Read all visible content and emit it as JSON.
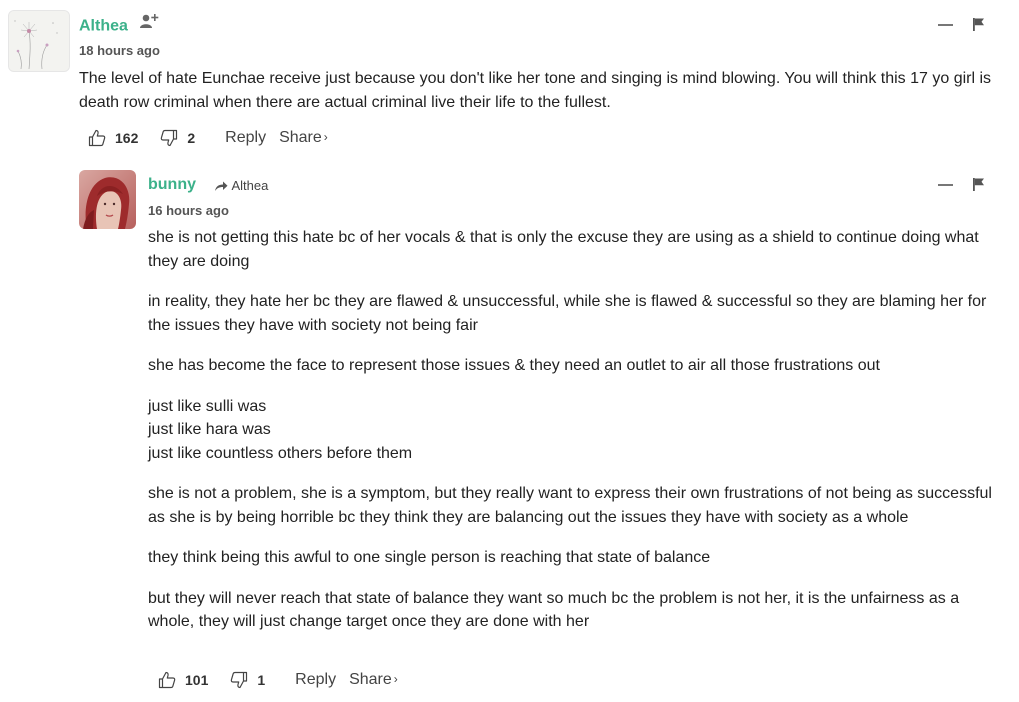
{
  "comments": [
    {
      "author": "Althea",
      "avatar_icon": "dandelion-avatar",
      "follow_icon": "add-user-icon",
      "time": "18 hours ago",
      "paragraphs": [
        "The level of hate Eunchae receive just because you don't like her tone and singing is mind blowing. You will think this 17 yo girl is death row criminal when there are actual criminal live their life to the fullest."
      ],
      "upvotes": "162",
      "downvotes": "2",
      "reply_label": "Reply",
      "share_label": "Share",
      "share_chevron": "›"
    },
    {
      "author": "bunny",
      "avatar_icon": "user-photo-avatar",
      "reply_icon": "reply-arrow-icon",
      "reply_to": "Althea",
      "time": "16 hours ago",
      "paragraphs": [
        "she is not getting this hate bc of her vocals & that is only the excuse they are using as a shield to continue doing what they are doing",
        "in reality, they hate her bc they are flawed & unsuccessful, while she is flawed & successful so they are blaming her for the issues they have with society not being fair",
        "she has become the face to represent those issues & they need an outlet to air all those frustrations out",
        "just like sulli was",
        "just like hara was",
        "just like countless others before them",
        "she is not a problem, she is a symptom, but they really want to express their own frustrations of not being as successful as she is by being horrible bc they think they are balancing out the issues they have with society as a whole",
        "they think being this awful to one single person is reaching that state of balance",
        "but they will never reach that state of balance they want so much bc the problem is not her, it is the unfairness as a whole, they will just change target once they are done with her"
      ],
      "upvotes": "101",
      "downvotes": "1",
      "reply_label": "Reply",
      "share_label": "Share",
      "share_chevron": "›"
    }
  ],
  "colors": {
    "author": "#3cb18a",
    "text": "#222222",
    "muted": "#555555"
  }
}
